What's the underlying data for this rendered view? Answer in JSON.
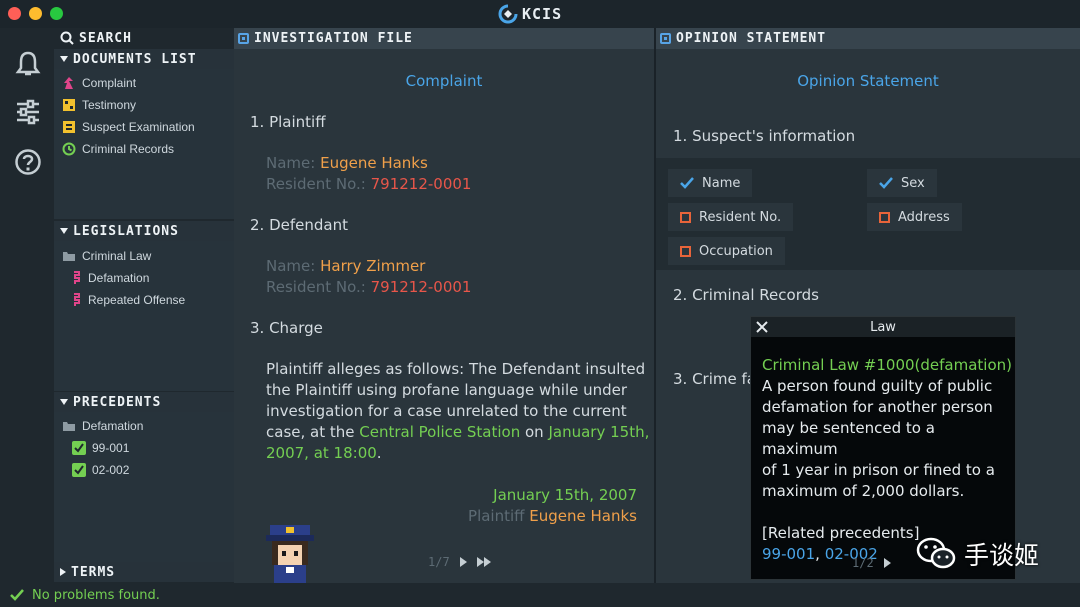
{
  "app": {
    "title": "KCIS",
    "accent": "#4aa5e8"
  },
  "window_controls": {
    "close_color": "#ff5f57",
    "minimize_color": "#febc2e",
    "maximize_color": "#28c840"
  },
  "rail": {
    "icons": [
      "bell-icon",
      "sliders-icon",
      "help-icon"
    ]
  },
  "sidebar": {
    "search_label": "SEARCH",
    "documents": {
      "title": "DOCUMENTS LIST",
      "items": [
        {
          "label": "Complaint",
          "icon": "complaint-icon"
        },
        {
          "label": "Testimony",
          "icon": "testimony-icon"
        },
        {
          "label": "Suspect Examination",
          "icon": "examination-icon"
        },
        {
          "label": "Criminal Records",
          "icon": "records-icon"
        }
      ]
    },
    "legislations": {
      "title": "LEGISLATIONS",
      "folder": "Criminal Law",
      "items": [
        "Defamation",
        "Repeated Offense"
      ]
    },
    "precedents": {
      "title": "PRECEDENTS",
      "folder": "Defamation",
      "items": [
        "99-001",
        "02-002"
      ]
    },
    "terms": {
      "title": "TERMS"
    }
  },
  "investigation": {
    "header": "INVESTIGATION FILE",
    "doc_title": "Complaint",
    "s1": "1. Plaintiff",
    "plaintiff": {
      "name_label": "Name:",
      "name": "Eugene Hanks",
      "res_label": "Resident No.:",
      "res_no": "791212-0001"
    },
    "s2": "2. Defendant",
    "defendant": {
      "name_label": "Name:",
      "name": "Harry Zimmer",
      "res_label": "Resident No.:",
      "res_no": "791212-0001"
    },
    "s3": "3. Charge",
    "charge": {
      "l1": "Plaintiff alleges as follows: The Defendant insulted",
      "l2": "the Plaintiff using profane language while under",
      "l3": "investigation for a case unrelated to the current",
      "l4a": "case, at the ",
      "l4b": "Central Police Station",
      "l4c": " on ",
      "l4d": "January 15th,",
      "l5": "2007, at 18:00",
      "l5b": "."
    },
    "sign_date": "January 15th, 2007",
    "sign_label": "Plaintiff",
    "sign_name": "Eugene Hanks",
    "pager": "1/7"
  },
  "opinion": {
    "header": "OPINION STATEMENT",
    "doc_title": "Opinion Statement",
    "s1": "1. Suspect's information",
    "fields": [
      {
        "label": "Name",
        "checked": true
      },
      {
        "label": "Sex",
        "checked": true
      },
      {
        "label": "Resident No.",
        "checked": false
      },
      {
        "label": "Address",
        "checked": false
      },
      {
        "label": "Occupation",
        "checked": false
      }
    ],
    "s2": "2. Criminal Records",
    "s3": "3. Crime fa"
  },
  "law_popup": {
    "title": "Law",
    "law_name": "Criminal Law #1000(defamation)",
    "lines": [
      "A person found guilty of public",
      "defamation for another person",
      "may be sentenced to a maximum",
      "of 1 year in prison or fined to a",
      "maximum of 2,000 dollars."
    ],
    "related_label": "[Related precedents]",
    "precedent_1": "99-001",
    "precedent_sep": ",",
    "precedent_2": "02-002",
    "pager": "1/2"
  },
  "status": {
    "text": "No problems found."
  },
  "watermark": {
    "text": "手谈姬"
  }
}
